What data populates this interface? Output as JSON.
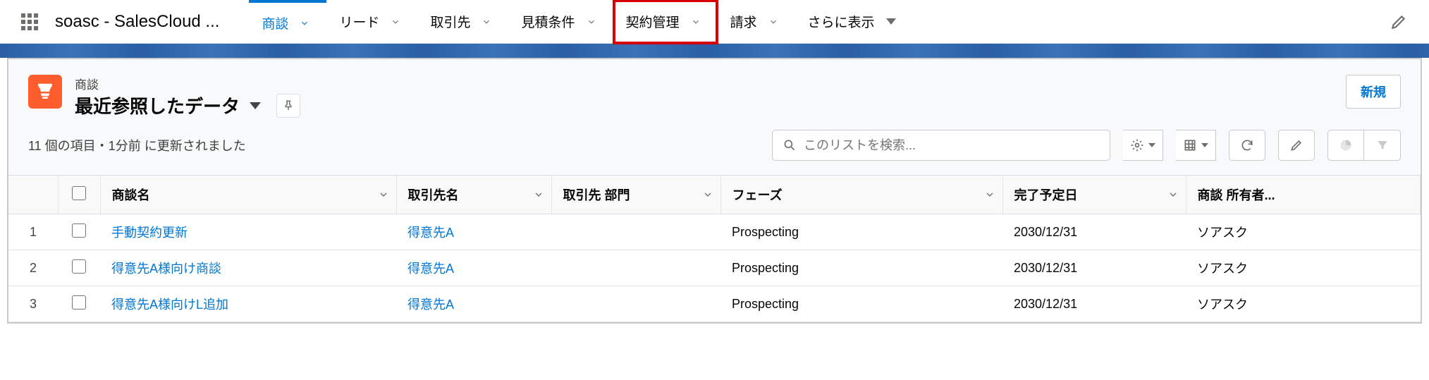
{
  "app_name": "soasc - SalesCloud ...",
  "nav": {
    "items": [
      {
        "label": "商談",
        "active": true,
        "highlight": false
      },
      {
        "label": "リード",
        "active": false,
        "highlight": false
      },
      {
        "label": "取引先",
        "active": false,
        "highlight": false
      },
      {
        "label": "見積条件",
        "active": false,
        "highlight": false
      },
      {
        "label": "契約管理",
        "active": false,
        "highlight": true
      },
      {
        "label": "請求",
        "active": false,
        "highlight": false
      },
      {
        "label": "さらに表示",
        "active": false,
        "highlight": false,
        "caret": "fill"
      }
    ]
  },
  "header": {
    "object_label": "商談",
    "view_name": "最近参照したデータ",
    "new_button": "新規"
  },
  "status": "11 個の項目・1分前 に更新されました",
  "search": {
    "placeholder": "このリストを検索..."
  },
  "columns": [
    "商談名",
    "取引先名",
    "取引先 部門",
    "フェーズ",
    "完了予定日",
    "商談 所有者..."
  ],
  "rows": [
    {
      "num": "1",
      "name": "手動契約更新",
      "account": "得意先A",
      "dept": "",
      "phase": "Prospecting",
      "close": "2030/12/31",
      "owner": "ソアスク"
    },
    {
      "num": "2",
      "name": "得意先A様向け商談",
      "account": "得意先A",
      "dept": "",
      "phase": "Prospecting",
      "close": "2030/12/31",
      "owner": "ソアスク"
    },
    {
      "num": "3",
      "name": "得意先A様向けL追加",
      "account": "得意先A",
      "dept": "",
      "phase": "Prospecting",
      "close": "2030/12/31",
      "owner": "ソアスク"
    }
  ]
}
